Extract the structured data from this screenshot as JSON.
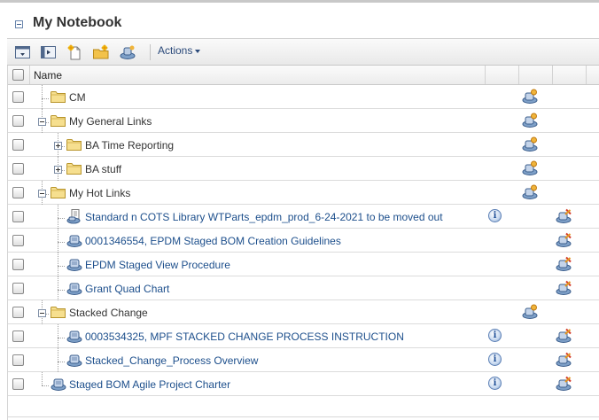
{
  "panel": {
    "title": "My Notebook"
  },
  "toolbar": {
    "actions_label": "Actions",
    "buttons": [
      "collapse-all-icon",
      "expand-all-icon",
      "new-document-icon",
      "new-folder-icon",
      "add-link-icon"
    ]
  },
  "grid": {
    "header": {
      "name": "Name"
    },
    "rows": [
      {
        "label": "CM",
        "type": "folder",
        "depth": 1,
        "expander": "none",
        "link": false,
        "info": false,
        "col3": "link-folder-icon",
        "col4": ""
      },
      {
        "label": "My General Links",
        "type": "folder",
        "depth": 1,
        "expander": "minus",
        "link": false,
        "info": false,
        "col3": "link-folder-icon",
        "col4": ""
      },
      {
        "label": "BA Time Reporting",
        "type": "folder",
        "depth": 2,
        "expander": "plus",
        "link": false,
        "info": false,
        "col3": "link-folder-icon",
        "col4": ""
      },
      {
        "label": "BA stuff",
        "type": "folder",
        "depth": 2,
        "expander": "plus",
        "link": false,
        "info": false,
        "col3": "link-folder-icon",
        "col4": ""
      },
      {
        "label": "My Hot Links",
        "type": "folder",
        "depth": 1,
        "expander": "minus",
        "link": false,
        "info": false,
        "col3": "link-folder-icon",
        "col4": ""
      },
      {
        "label": "Standard n COTS Library WTParts_epdm_prod_6-24-2021 to be moved out",
        "type": "doc",
        "depth": 2,
        "expander": "none",
        "link": true,
        "info": true,
        "col3": "",
        "col4": "remove-link-icon"
      },
      {
        "label": "0001346554, EPDM Staged BOM Creation Guidelines",
        "type": "link",
        "depth": 2,
        "expander": "none",
        "link": true,
        "info": false,
        "col3": "",
        "col4": "remove-link-icon"
      },
      {
        "label": "EPDM Staged View Procedure",
        "type": "link",
        "depth": 2,
        "expander": "none",
        "link": true,
        "info": false,
        "col3": "",
        "col4": "remove-link-icon"
      },
      {
        "label": "Grant Quad Chart",
        "type": "link",
        "depth": 2,
        "expander": "none",
        "link": true,
        "info": false,
        "col3": "",
        "col4": "remove-link-icon"
      },
      {
        "label": "Stacked Change",
        "type": "folder",
        "depth": 1,
        "expander": "minus",
        "link": false,
        "info": false,
        "col3": "link-folder-icon",
        "col4": ""
      },
      {
        "label": "0003534325, MPF STACKED CHANGE PROCESS INSTRUCTION",
        "type": "link",
        "depth": 2,
        "expander": "none",
        "link": true,
        "info": true,
        "col3": "",
        "col4": "remove-link-icon"
      },
      {
        "label": "Stacked_Change_Process Overview",
        "type": "link",
        "depth": 2,
        "expander": "none",
        "link": true,
        "info": true,
        "col3": "",
        "col4": "remove-link-icon"
      },
      {
        "label": "Staged BOM Agile Project Charter",
        "type": "link",
        "depth": 1,
        "expander": "none",
        "link": true,
        "info": true,
        "col3": "",
        "col4": "remove-link-icon"
      }
    ]
  },
  "colors": {
    "link": "#1d4f8c",
    "folder": "#f2d27a",
    "header_bg": "#ececec"
  }
}
